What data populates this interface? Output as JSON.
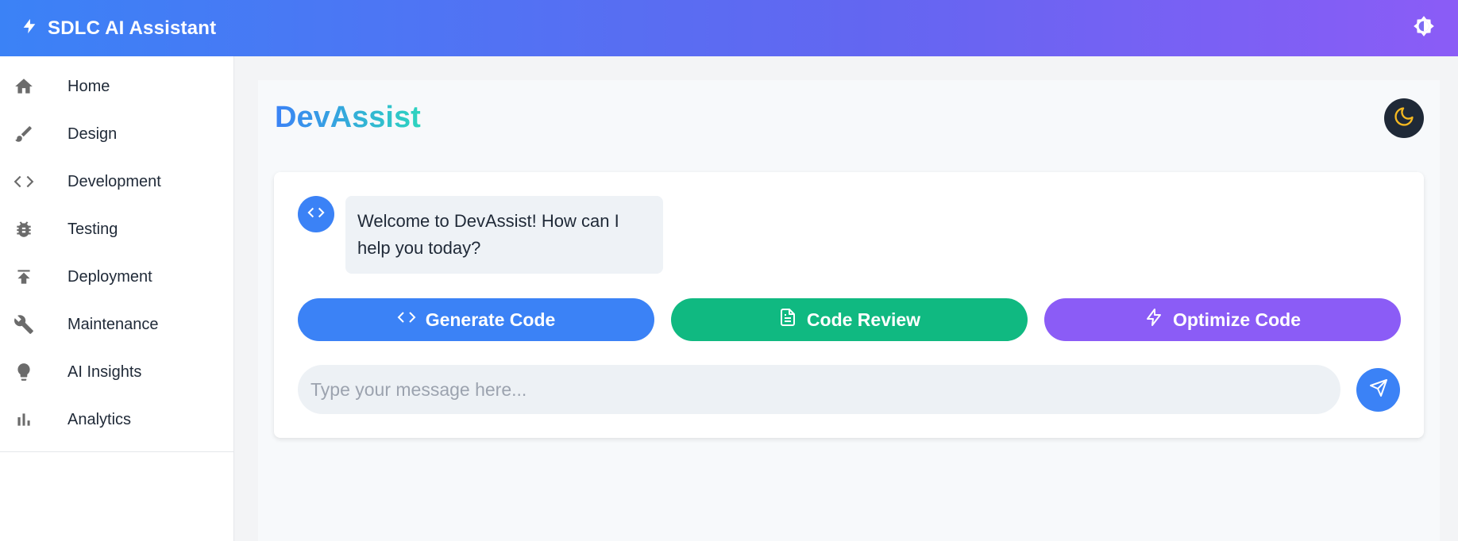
{
  "header": {
    "title": "SDLC AI Assistant",
    "icon": "lightning-icon",
    "theme_icon": "brightness-icon"
  },
  "sidebar": {
    "items": [
      {
        "label": "Home",
        "icon": "home-icon"
      },
      {
        "label": "Design",
        "icon": "brush-icon"
      },
      {
        "label": "Development",
        "icon": "code-icon"
      },
      {
        "label": "Testing",
        "icon": "bug-icon"
      },
      {
        "label": "Deployment",
        "icon": "upload-icon"
      },
      {
        "label": "Maintenance",
        "icon": "wrench-icon"
      },
      {
        "label": "AI Insights",
        "icon": "lightbulb-icon"
      },
      {
        "label": "Analytics",
        "icon": "bar-chart-icon"
      }
    ]
  },
  "main": {
    "title": "DevAssist",
    "dark_mode_icon": "moon-icon",
    "chat": {
      "messages": [
        {
          "sender": "bot",
          "text": "Welcome to DevAssist! How can I help you today?"
        }
      ],
      "actions": [
        {
          "label": "Generate Code",
          "icon": "code-icon",
          "color": "#3b82f6"
        },
        {
          "label": "Code Review",
          "icon": "document-icon",
          "color": "#10b981"
        },
        {
          "label": "Optimize Code",
          "icon": "lightning-icon",
          "color": "#8b5cf6"
        }
      ],
      "input": {
        "placeholder": "Type your message here...",
        "value": ""
      },
      "send_icon": "send-icon"
    }
  },
  "colors": {
    "header_gradient_start": "#3b82f6",
    "header_gradient_end": "#8b5cf6",
    "accent": "#3b82f6"
  }
}
